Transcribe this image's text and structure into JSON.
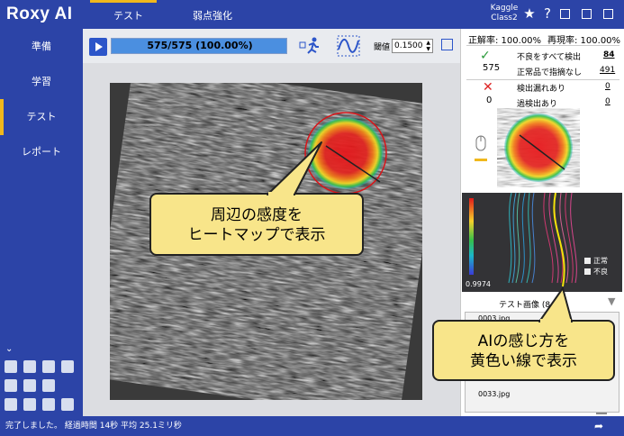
{
  "app": {
    "brand": "Roxy AI",
    "project_line1": "Kaggle",
    "project_line2": "Class2"
  },
  "tabs": [
    "テスト",
    "弱点強化"
  ],
  "sidebar": [
    "準備",
    "学習",
    "テスト",
    "レポート"
  ],
  "toolbar": {
    "progress_text": "575/575 (100.00%)",
    "progress_value": 1.0,
    "threshold_label": "閾値",
    "threshold_value": "0.1500"
  },
  "metrics": {
    "accuracy": "正解率: 100.00%",
    "recall": "再現率: 100.00%"
  },
  "stats": {
    "ok_count": "575",
    "ng_count": "0",
    "detect_all_label": "不良をすべて検出",
    "detect_all_value": "84",
    "normal_no_flag_label": "正常品で指摘なし",
    "normal_no_flag_value": "491",
    "miss_label": "検出漏れあり",
    "miss_value": "0",
    "over_label": "過検出あり",
    "over_value": "0"
  },
  "chart": {
    "min_label": "0.9974",
    "legend_normal": "正常",
    "legend_defect": "不良"
  },
  "test_images": {
    "header": "テスト画像 (84",
    "items": [
      "0003.jpg",
      "0033.jpg"
    ]
  },
  "callouts": {
    "heatmap": [
      "周辺の感度を",
      "ヒートマップで表示"
    ],
    "line": [
      "AIの感じ方を",
      "黄色い線で表示"
    ]
  },
  "status": {
    "text": "完了しました。 経過時間 14秒  平均 25.1ミリ秒"
  },
  "colors": {
    "brand": "#2c44a7",
    "accent": "#f0b81d",
    "callout": "#f8e58a"
  }
}
